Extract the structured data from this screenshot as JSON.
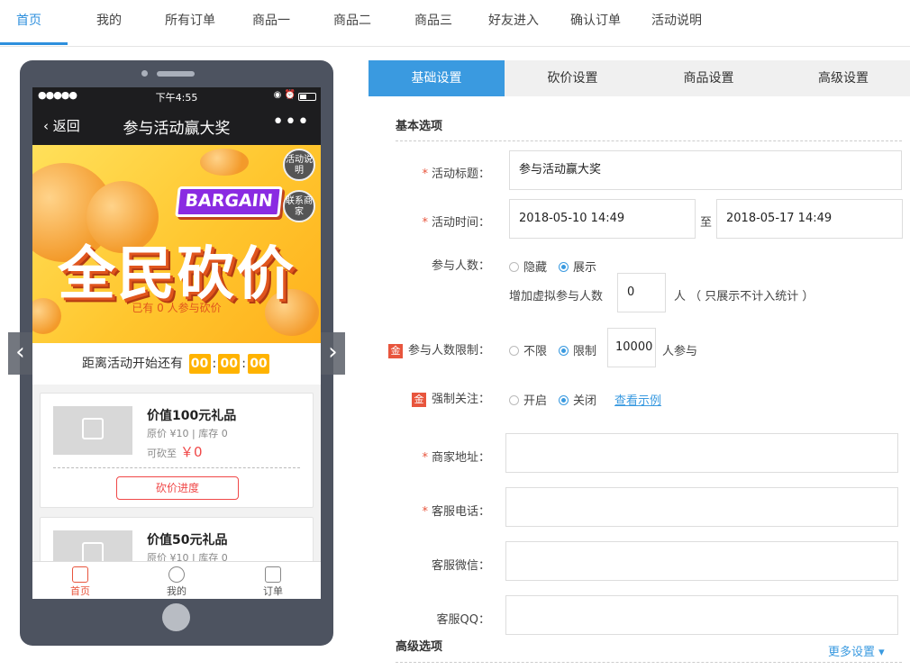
{
  "top_nav": [
    "首页",
    "我的",
    "所有订单",
    "商品一",
    "商品二",
    "商品三",
    "好友进入",
    "确认订单",
    "活动说明"
  ],
  "phone": {
    "status_time": "下午4:55",
    "signal": "●●●●●",
    "nav_back": "返回",
    "nav_title": "参与活动赢大奖",
    "nav_more": "•••",
    "banner": {
      "badge_rules": "活动说明",
      "badge_contact": "联系商家",
      "bargain": "BARGAIN",
      "headline": "全民砍价",
      "joined": "已有 0 人参与砍价"
    },
    "countdown": {
      "label": "距离活动开始还有",
      "h": "00",
      "m": "00",
      "s": "00",
      "sep": ":"
    },
    "products": [
      {
        "name": "价值100元礼品",
        "meta": "原价 ¥10 | 库存 0",
        "price_label": "可砍至",
        "price": "￥0",
        "button": "砍价进度"
      },
      {
        "name": "价值50元礼品",
        "meta": "原价 ¥10 | 库存 0"
      }
    ],
    "tabbar": [
      "首页",
      "我的",
      "订单"
    ],
    "arrow_prev": "‹",
    "arrow_next": "›"
  },
  "settings": {
    "tabs": [
      "基础设置",
      "砍价设置",
      "商品设置",
      "高级设置"
    ],
    "basic_section": "基本选项",
    "advanced_section": "高级选项",
    "more_settings": "更多设置 ▾",
    "gold_tag": "金",
    "required_mark": "*",
    "fields": {
      "title_label": "活动标题：",
      "title_value": "参与活动赢大奖",
      "time_label": "活动时间：",
      "time_start": "2018-05-10 14:49",
      "time_to": "至",
      "time_end": "2018-05-17 14:49",
      "participants_label": "参与人数：",
      "participants_hide": "隐藏",
      "participants_show": "展示",
      "virtual_label": "增加虚拟参与人数",
      "virtual_value": "0",
      "virtual_note": "人 （ 只展示不计入统计 ）",
      "limit_label": "参与人数限制：",
      "limit_none": "不限",
      "limit_on": "限制",
      "limit_value": "10000",
      "limit_unit": "人参与",
      "follow_label": "强制关注：",
      "follow_on": "开启",
      "follow_off": "关闭",
      "follow_example": "查看示例",
      "address_label": "商家地址：",
      "phone_label": "客服电话：",
      "wechat_label": "客服微信：",
      "qq_label": "客服QQ："
    }
  },
  "colors": {
    "accent": "#3a9ae0",
    "required": "#e8553d",
    "price": "#f04848",
    "countdown": "#ffb300"
  }
}
